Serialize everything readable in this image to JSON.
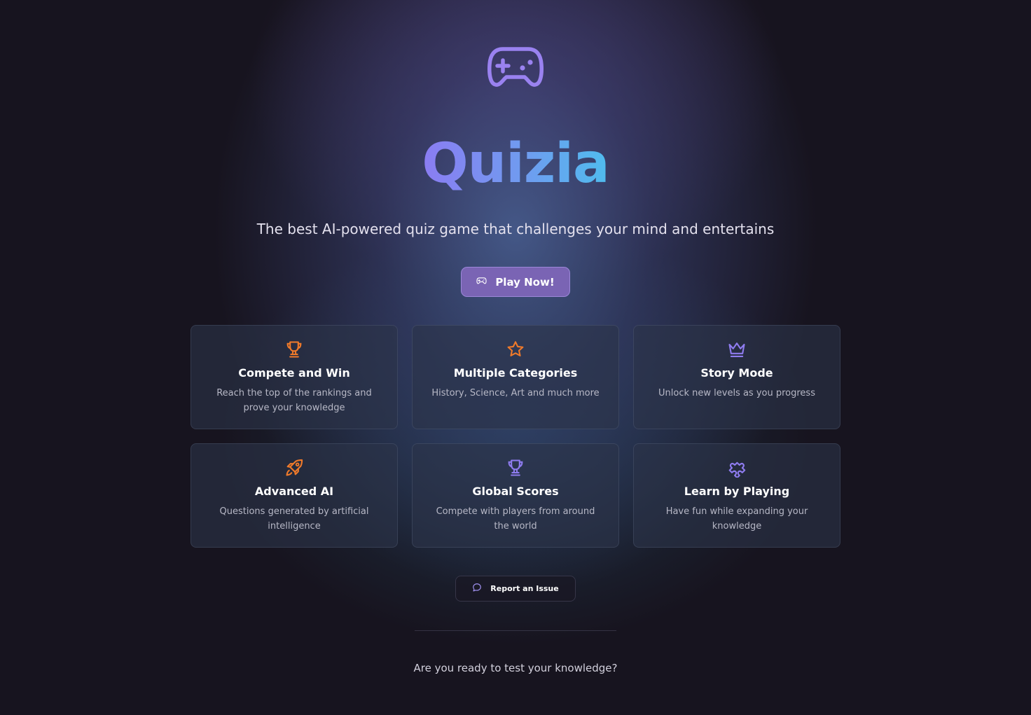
{
  "app": {
    "logo_icon": "gamepad-icon",
    "title": "Quizia",
    "tagline": "The best AI-powered quiz game that challenges your mind and entertains"
  },
  "actions": {
    "play_label": "Play Now!",
    "play_icon": "gamepad-icon",
    "report_label": "Report an Issue",
    "report_icon": "message-circle-icon"
  },
  "features": [
    {
      "icon": "trophy-icon",
      "title": "Compete and Win",
      "description": "Reach the top of the rankings and prove your knowledge"
    },
    {
      "icon": "star-icon",
      "title": "Multiple Categories",
      "description": "History, Science, Art and much more"
    },
    {
      "icon": "crown-icon",
      "title": "Story Mode",
      "description": "Unlock new levels as you progress"
    },
    {
      "icon": "rocket-icon",
      "title": "Advanced AI",
      "description": "Questions generated by artificial intelligence"
    },
    {
      "icon": "trophy-icon",
      "title": "Global Scores",
      "description": "Compete with players from around the world"
    },
    {
      "icon": "puzzle-icon",
      "title": "Learn by Playing",
      "description": "Have fun while expanding your knowledge"
    }
  ],
  "footer": {
    "prompt": "Are you ready to test your knowledge?"
  },
  "colors": {
    "background": "#17141f",
    "accent_purple": "#8b7cf2",
    "accent_blue": "#4fbcee",
    "icon_orange": "#f07a2a",
    "icon_purple": "#8f7cf0",
    "button_purple": "#7a64b4"
  }
}
